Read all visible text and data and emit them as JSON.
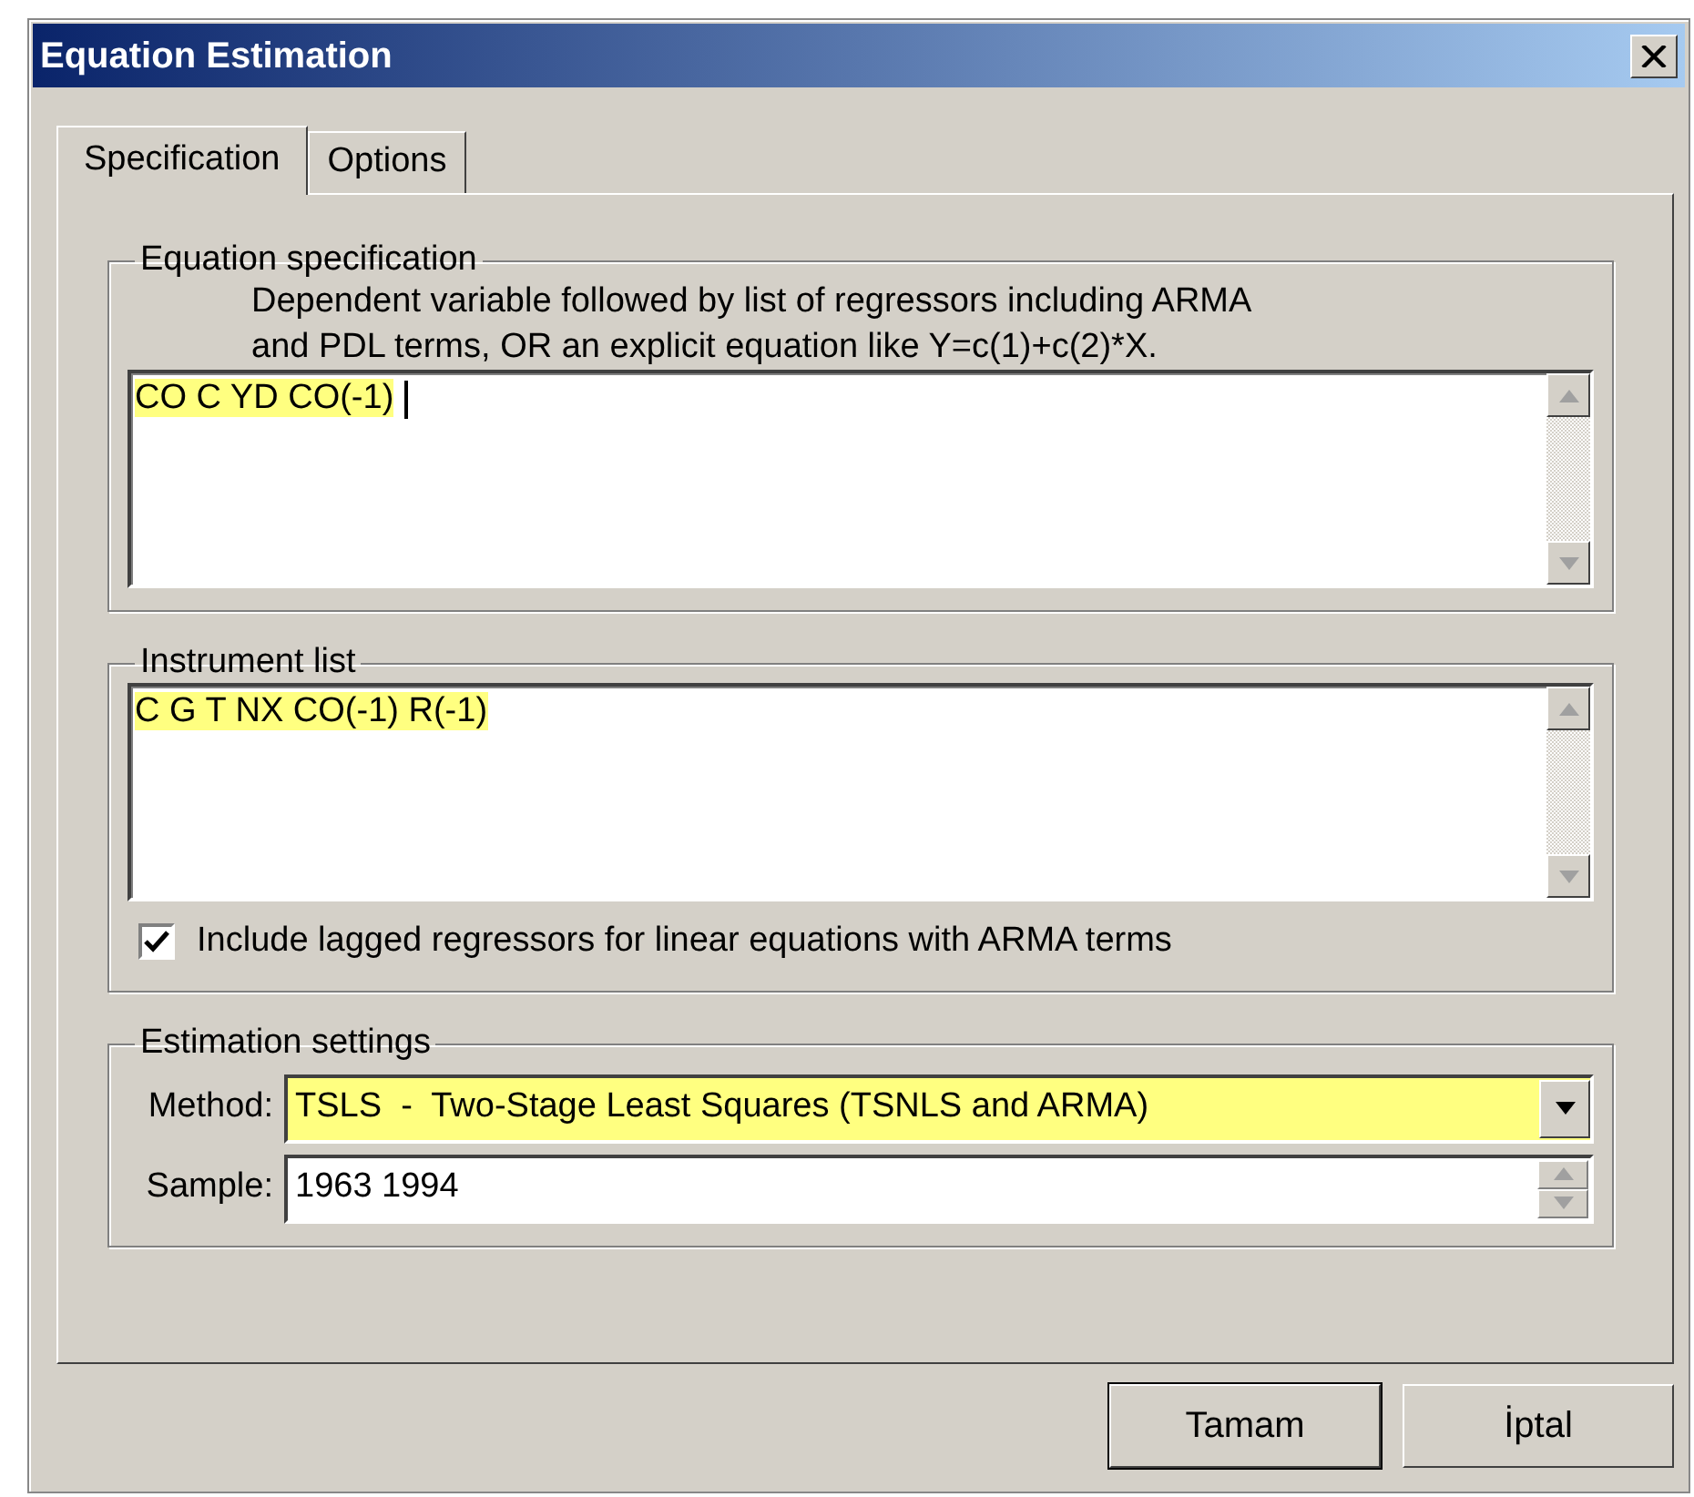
{
  "window": {
    "title": "Equation Estimation"
  },
  "tabs": [
    {
      "label": "Specification",
      "selected": true
    },
    {
      "label": "Options",
      "selected": false
    }
  ],
  "equation_specification": {
    "legend": "Equation specification",
    "description": [
      "Dependent variable followed by list of regressors including ARMA",
      "and PDL terms, OR an explicit equation like Y=c(1)+c(2)*X."
    ],
    "field": {
      "value": "CO C YD CO(-1)",
      "highlighted": true,
      "focused": true
    }
  },
  "instrument_list": {
    "legend": "Instrument list",
    "field": {
      "value": "C G T NX CO(-1) R(-1)",
      "highlighted": true,
      "focused": false
    },
    "checkbox": {
      "label": "Include lagged regressors for linear equations with ARMA terms",
      "checked": true
    }
  },
  "estimation_settings": {
    "legend": "Estimation settings",
    "method": {
      "label": "Method:",
      "value": "TSLS  -  Two-Stage Least Squares (TSNLS and ARMA)",
      "highlighted": true
    },
    "sample": {
      "label": "Sample:",
      "value": "1963 1994",
      "highlighted": false
    }
  },
  "buttons": [
    {
      "label": "Tamam",
      "default": true
    },
    {
      "label": "İptal",
      "default": false
    }
  ]
}
